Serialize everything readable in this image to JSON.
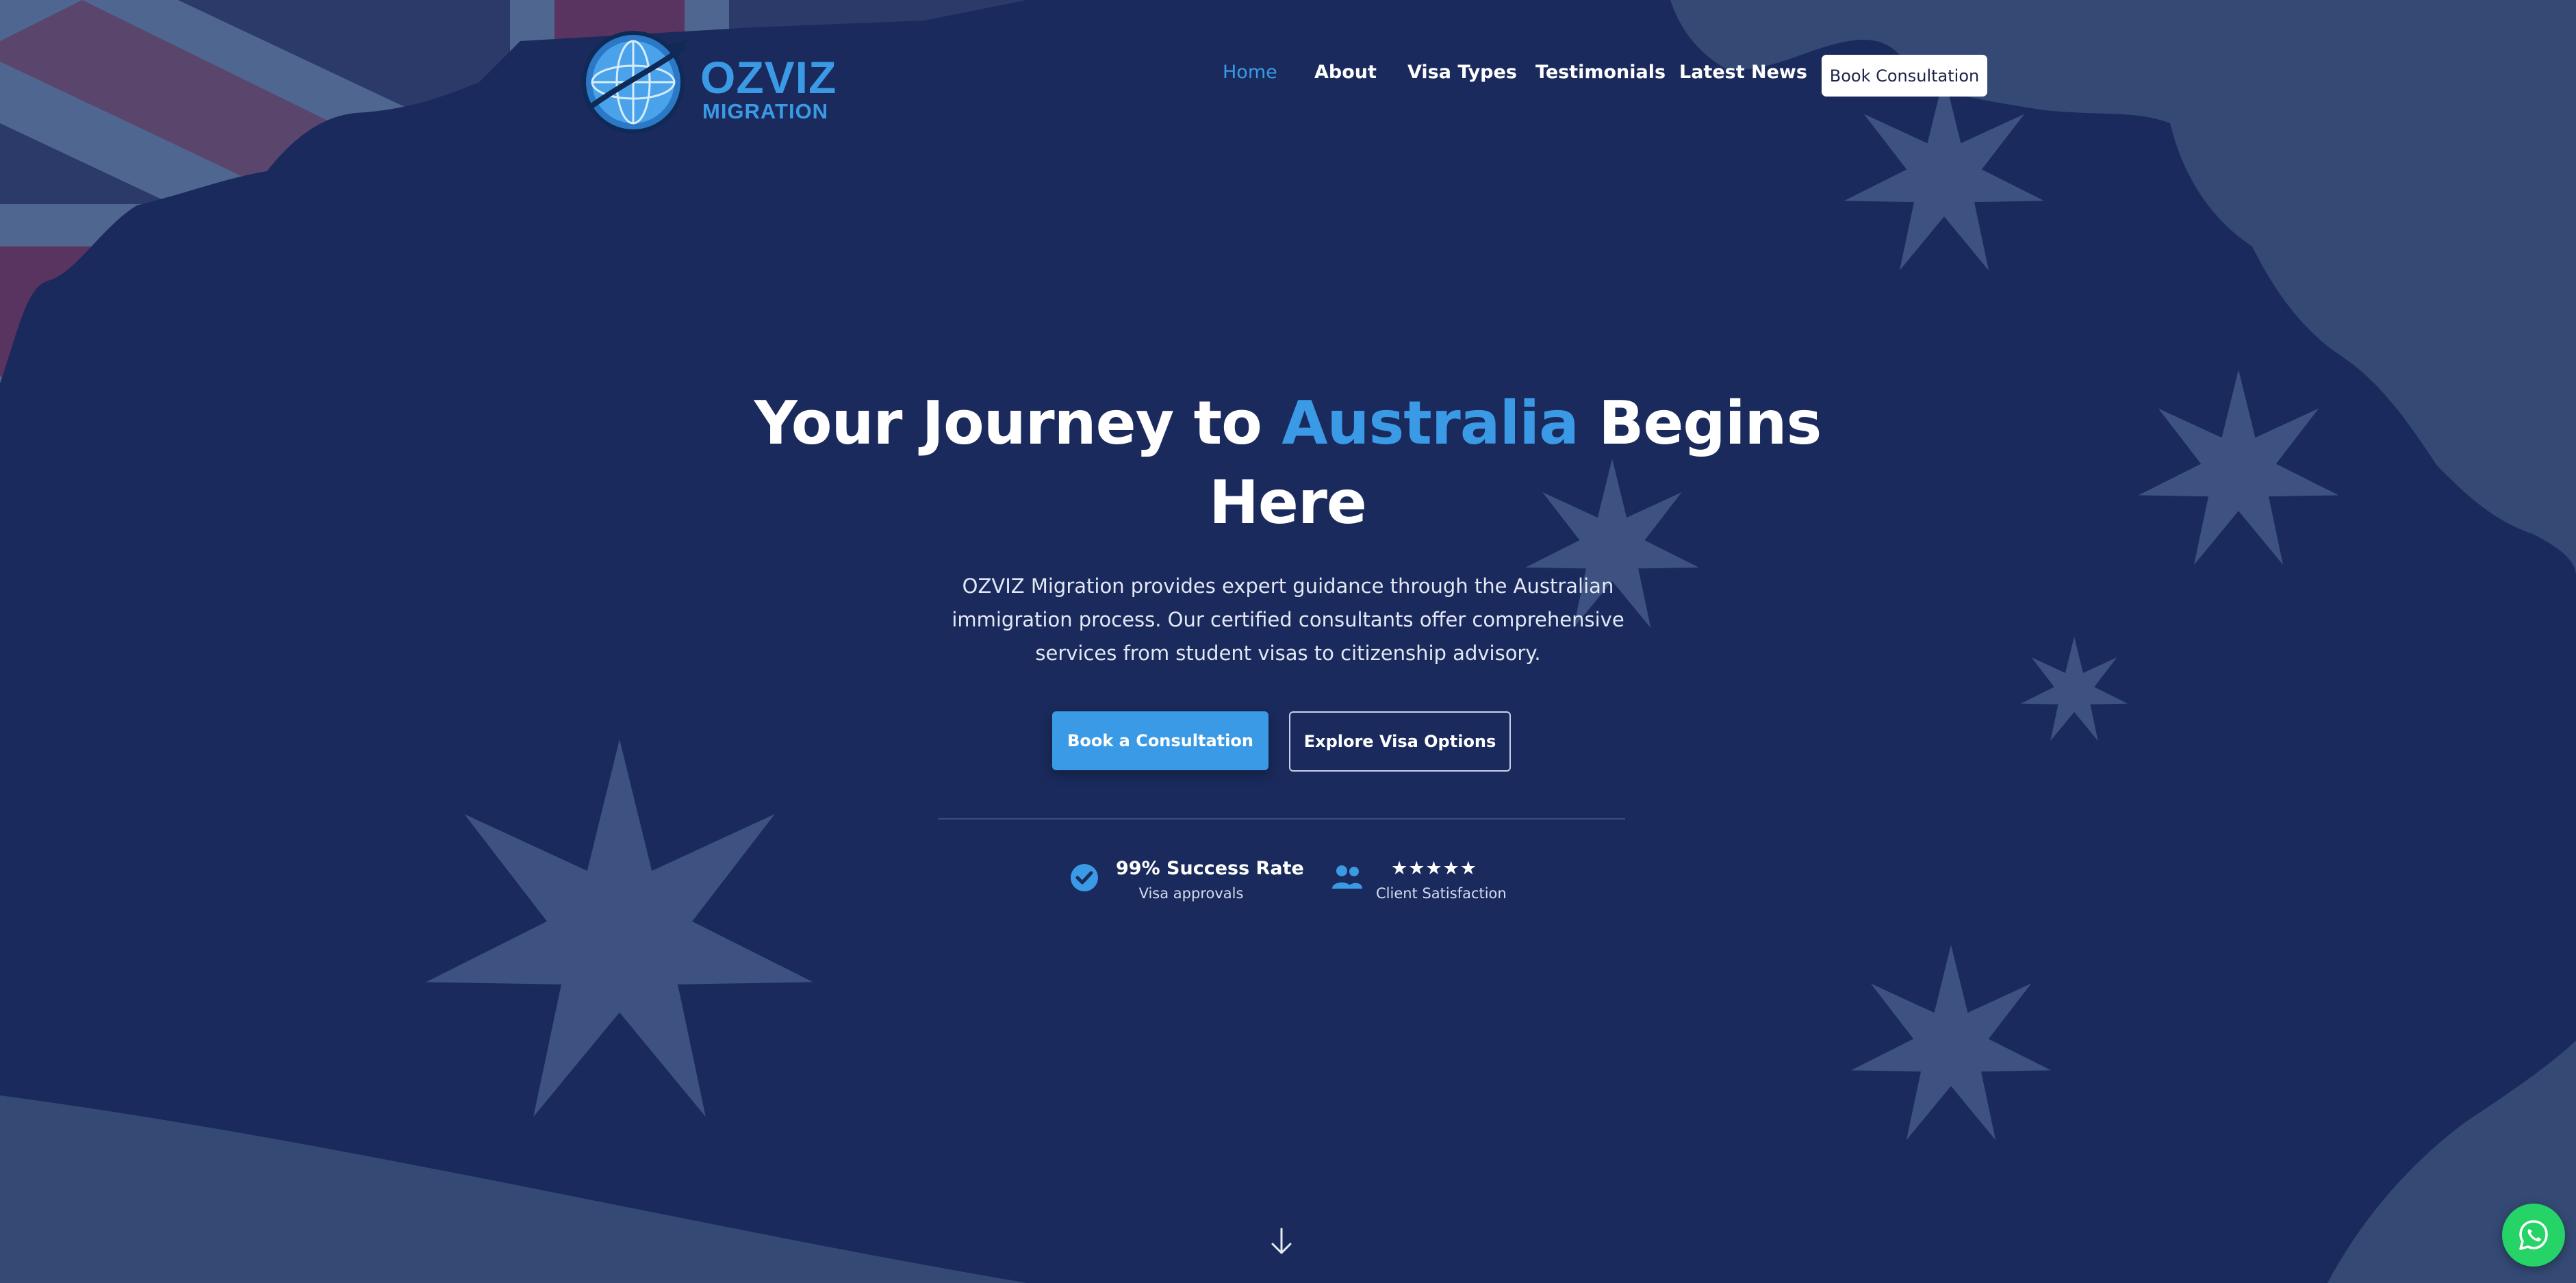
{
  "brand": {
    "name_line1": "OZVIZ",
    "name_line2": "MIGRATION",
    "logo_icon": "globe-airplane-icon",
    "accent_color": "#3b9ae6"
  },
  "nav": {
    "items": [
      {
        "label": "Home",
        "active": true
      },
      {
        "label": "About",
        "active": false
      },
      {
        "label": "Visa Types",
        "active": false
      },
      {
        "label": "Testimonials",
        "active": false
      },
      {
        "label": "Latest News",
        "active": false
      }
    ],
    "cta_label": "Book Consultation"
  },
  "hero": {
    "headline_pre": "Your Journey to ",
    "headline_accent": "Australia",
    "headline_post": " Begins Here",
    "description": "OZVIZ Migration provides expert guidance through the Australian immigration process. Our certified consultants offer comprehensive services from student visas to citizenship advisory.",
    "primary_button": "Book a Consultation",
    "secondary_button": "Explore Visa Options"
  },
  "stats": [
    {
      "icon": "check-circle-icon",
      "title": "99% Success Rate",
      "subtitle": "Visa approvals"
    },
    {
      "icon": "users-icon",
      "title": "★★★★★",
      "subtitle": "Client Satisfaction"
    }
  ],
  "background": {
    "theme": "australian-flag-and-map",
    "base_color": "#1a2a5c"
  },
  "icons": {
    "scroll": "arrow-down-icon",
    "chat": "whatsapp-icon"
  }
}
